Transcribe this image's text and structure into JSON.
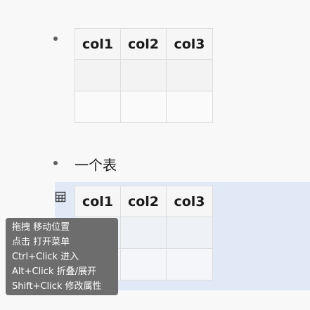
{
  "blocks": [
    {
      "headers": [
        "col1",
        "col2",
        "col3"
      ]
    },
    {
      "text": "一个表"
    },
    {
      "headers": [
        "col1",
        "col2",
        "col3"
      ]
    }
  ],
  "handle_icon": "table-grid-icon",
  "tooltip": {
    "lines": [
      "拖拽 移动位置",
      "点击 打开菜单",
      "Ctrl+Click 进入",
      "Alt+Click 折叠/展开",
      "Shift+Click 修改属性"
    ]
  },
  "colors": {
    "background": "#f8f8f9",
    "selection": "#e2e9f6",
    "tooltip_bg": "#6d6d6d"
  }
}
